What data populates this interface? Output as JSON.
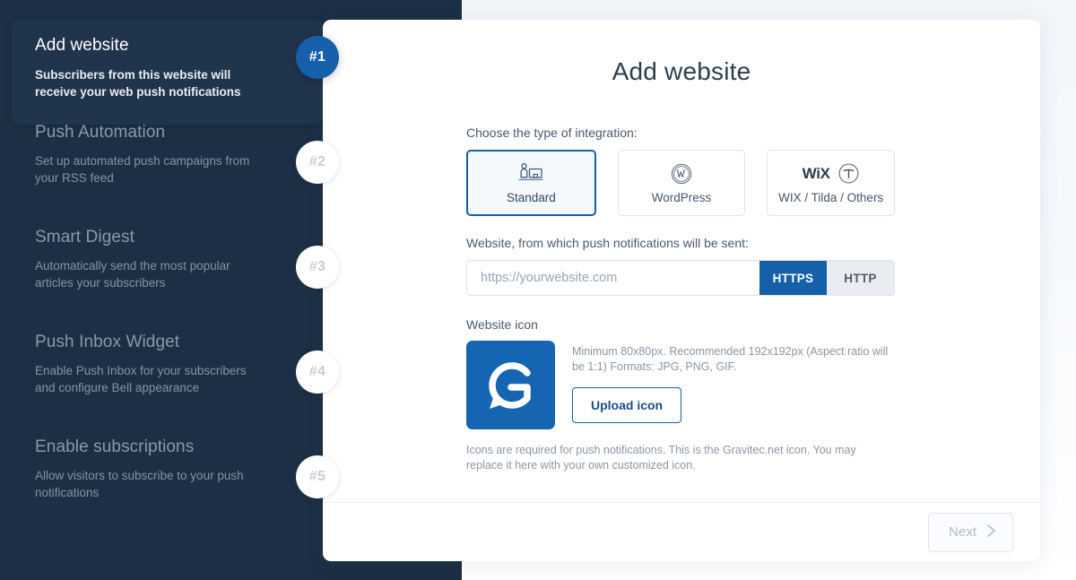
{
  "sidebar": {
    "steps": [
      {
        "badge": "#1",
        "title": "Add website",
        "desc": "Subscribers from this website will receive your web push notifications",
        "active": true
      },
      {
        "badge": "#2",
        "title": "Push Automation",
        "desc": "Set up automated push campaigns from your RSS feed",
        "active": false
      },
      {
        "badge": "#3",
        "title": "Smart Digest",
        "desc": "Automatically send the most popular articles your subscribers",
        "active": false
      },
      {
        "badge": "#4",
        "title": "Push Inbox Widget",
        "desc": "Enable Push Inbox for your subscribers and configure Bell appearance",
        "active": false
      },
      {
        "badge": "#5",
        "title": "Enable subscriptions",
        "desc": "Allow visitors to subscribe to your push notifications",
        "active": false
      }
    ]
  },
  "panel": {
    "title": "Add website",
    "integration": {
      "label": "Choose the type of integration:",
      "options": [
        {
          "label": "Standard",
          "icon": "person-monitor-icon",
          "selected": true
        },
        {
          "label": "WordPress",
          "icon": "wordpress-icon",
          "selected": false
        },
        {
          "label": "WIX / Tilda / Others",
          "icon": "wix-tilda-icon",
          "logo_text": "WiX",
          "selected": false
        }
      ]
    },
    "website": {
      "label": "Website, from which push notifications will be sent:",
      "placeholder": "https://yourwebsite.com",
      "value": "",
      "protocol_https": "HTTPS",
      "protocol_http": "HTTP",
      "protocol_selected": "HTTPS"
    },
    "icon_section": {
      "label": "Website icon",
      "hint": "Minimum 80x80px. Recommended 192x192px (Aspect ratio will be 1:1) Formats: JPG, PNG, GIF.",
      "upload_label": "Upload icon",
      "note": "Icons are required for push notifications. This is the Gravitec.net icon. You may replace it here with your own customized icon."
    },
    "footer": {
      "next_label": "Next"
    }
  },
  "colors": {
    "sidebar_bg": "#1d2f44",
    "sidebar_active_bg": "#20344b",
    "accent_blue": "#1560a8",
    "icon_tile_blue": "#1565b3",
    "muted_text": "#8494a6",
    "disabled_text": "#b3bdca"
  }
}
